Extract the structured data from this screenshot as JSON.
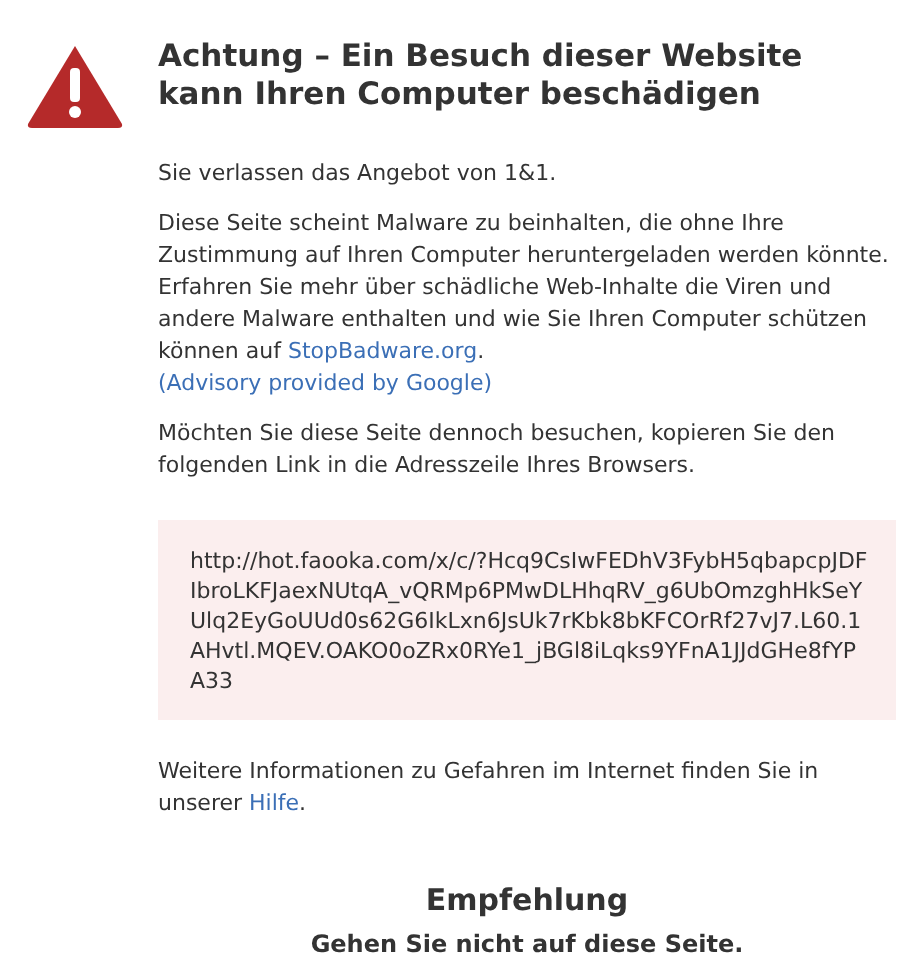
{
  "title": "Achtung – Ein Besuch dieser Website kann Ihren Computer beschädigen",
  "leaving": "Sie verlassen das Angebot von 1&1.",
  "malware": {
    "text": "Diese Seite scheint Malware zu beinhalten, die ohne Ihre Zustimmung auf Ihren Computer heruntergeladen werden könnte. Erfahren Sie mehr über schädliche Web-Inhalte die Viren und andere Malware enthalten und wie Sie Ihren Computer schützen können auf ",
    "link": "StopBadware.org",
    "after": "."
  },
  "advisory_link": "(Advisory provided by Google)",
  "visit_hint": "Möchten Sie diese Seite dennoch besuchen, kopieren Sie den folgenden Link in die Adresszeile Ihres Browsers.",
  "url": "http://hot.faooka.com/x/c/?Hcq9CsIwFEDhV3FybH5qbapcpJDFIbroLKFJaexNUtqA_vQRMp6PMwDLHhqRV_g6UbOmzghHkSeYUlq2EyGoUUd0s62G6IkLxn6JsUk7rKbk8bKFCOrRf27vJ7.L60.1AHvtl.MQEV.OAKO0oZRx0RYe1_jBGl8iLqks9YFnA1JJdGHe8fYPA33",
  "more_info": {
    "text": "Weitere Informationen zu Gefahren im Internet finden Sie in unserer ",
    "link": "Hilfe",
    "after": "."
  },
  "recommendation": {
    "heading": "Empfehlung",
    "text": "Gehen Sie nicht auf diese Seite."
  }
}
